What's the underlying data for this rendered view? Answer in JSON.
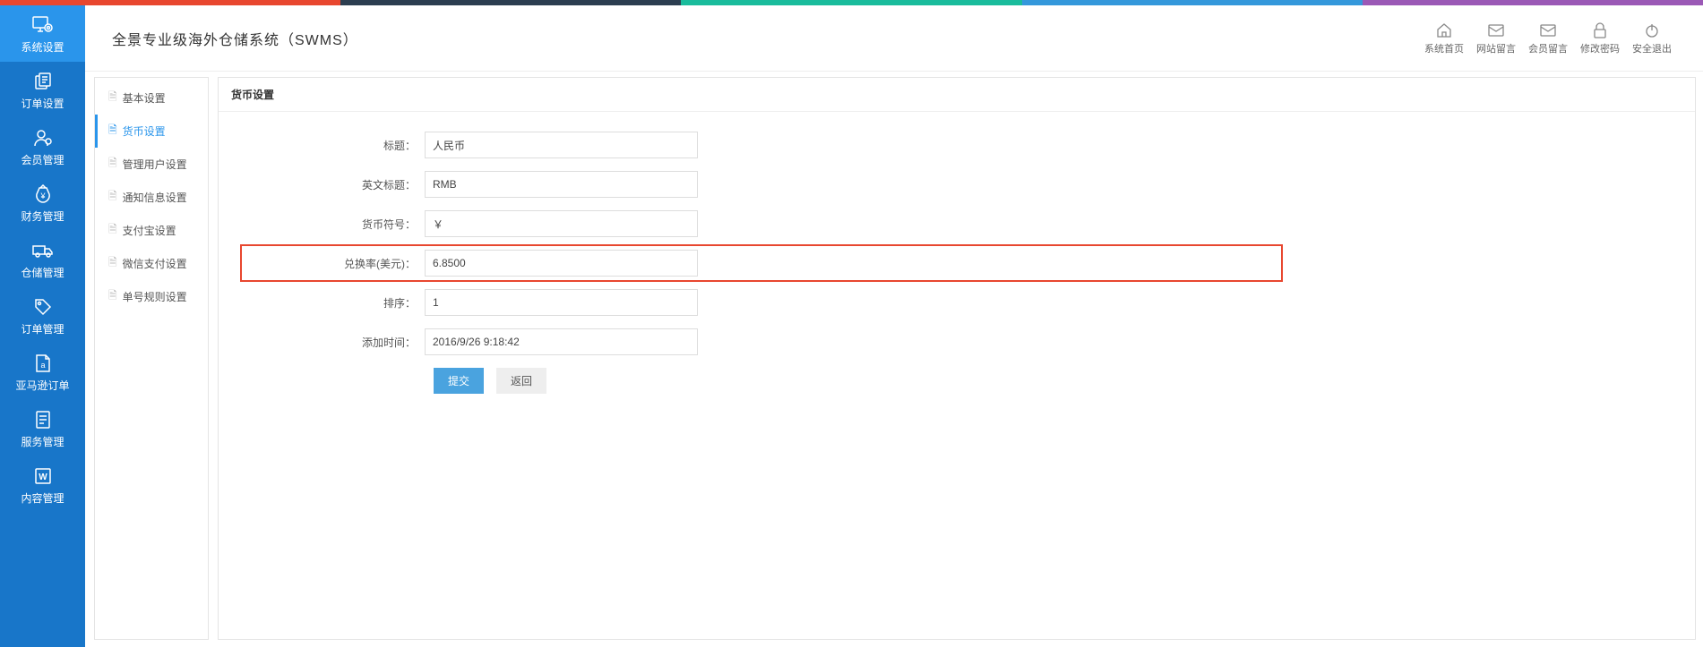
{
  "app_title": "全景专业级海外仓储系统（SWMS）",
  "header_actions": {
    "home": "系统首页",
    "site_msg": "网站留言",
    "member_msg": "会员留言",
    "change_pw": "修改密码",
    "logout": "安全退出"
  },
  "main_nav": {
    "system": "系统设置",
    "order_setup": "订单设置",
    "member": "会员管理",
    "finance": "财务管理",
    "warehouse": "仓储管理",
    "order_mgmt": "订单管理",
    "amazon": "亚马逊订单",
    "service": "服务管理",
    "content": "内容管理"
  },
  "sub_nav": {
    "basic": "基本设置",
    "currency": "货币设置",
    "admin_user": "管理用户设置",
    "notice": "通知信息设置",
    "alipay": "支付宝设置",
    "wechat": "微信支付设置",
    "number_rule": "单号规则设置"
  },
  "content_title": "货币设置",
  "form": {
    "labels": {
      "title": "标题：",
      "en_title": "英文标题：",
      "symbol": "货币符号：",
      "rate": "兑换率(美元)：",
      "sort": "排序：",
      "add_time": "添加时间："
    },
    "values": {
      "title": "人民币",
      "en_title": "RMB",
      "symbol": "￥",
      "rate": "6.8500",
      "sort": "1",
      "add_time": "2016/9/26 9:18:42"
    },
    "buttons": {
      "submit": "提交",
      "back": "返回"
    }
  }
}
